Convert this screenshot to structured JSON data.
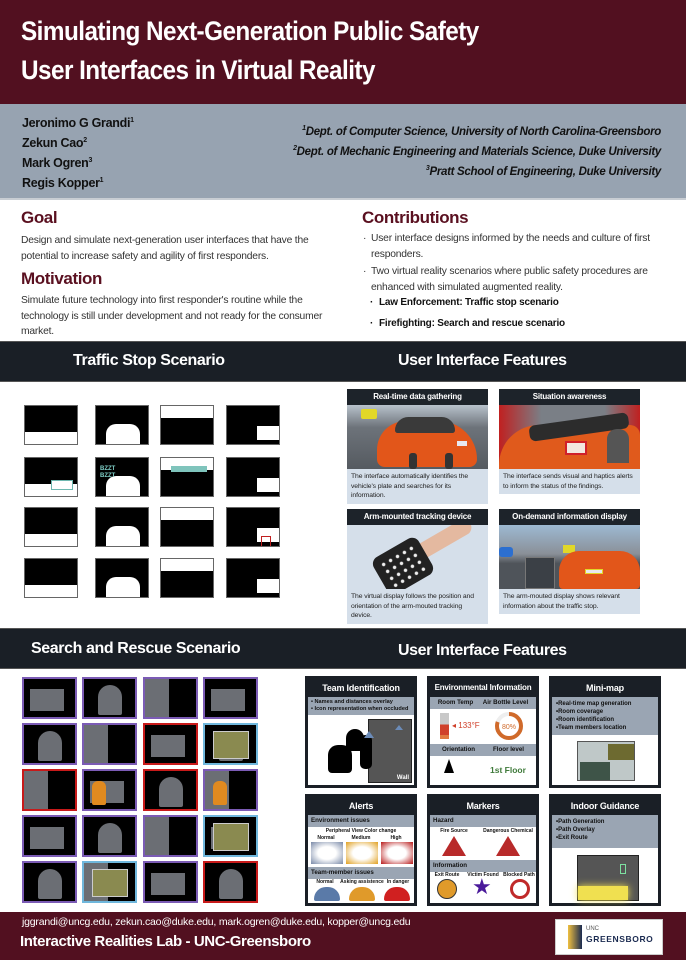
{
  "header": {
    "title_line1": "Simulating Next-Generation Public Safety",
    "title_line2": "User Interfaces in Virtual Reality"
  },
  "authors": [
    {
      "name": "Jeronimo G Grandi",
      "sup": "1"
    },
    {
      "name": "Zekun Cao",
      "sup": "2"
    },
    {
      "name": "Mark Ogren",
      "sup": "3"
    },
    {
      "name": "Regis Kopper",
      "sup": "1"
    }
  ],
  "affiliations": [
    {
      "sup": "1",
      "text": "Dept. of Computer Science, University of North Carolina-Greensboro"
    },
    {
      "sup": "2",
      "text": "Dept. of Mechanic Engineering and Materials Science, Duke University"
    },
    {
      "sup": "3",
      "text": "Pratt School of Engineering, Duke University"
    }
  ],
  "goal": {
    "heading": "Goal",
    "text": "Design and simulate next-generation user interfaces that have the potential to increase safety and agility of first responders."
  },
  "motivation": {
    "heading": "Motivation",
    "text": "Simulate future technology into first responder's routine while the technology is still under development and not ready for the consumer market."
  },
  "contributions": {
    "heading": "Contributions",
    "bullet": "·",
    "items": [
      "User interface designs informed by the needs and culture of first responders.",
      "Two virtual reality scenarios where public safety procedures are enhanced with simulated augmented reality."
    ],
    "subitems": [
      "Law Enforcement: Traffic stop scenario",
      "Firefighting: Search and rescue scenario"
    ]
  },
  "traffic_band": {
    "left_title": "Traffic Stop Scenario",
    "right_title": "User Interface Features"
  },
  "traffic_features": [
    {
      "title": "Real-time data gathering",
      "caption": "The interface automatically identifies the vehicle's plate and searches for its information."
    },
    {
      "title": "Situation awareness",
      "caption": "The interface sends visual and haptics alerts to inform the status of the findings."
    },
    {
      "title": "Arm-mounted tracking device",
      "caption": "The virtual display follows the position and orientation of the  arm-mouted tracking device."
    },
    {
      "title": "On-demand information display",
      "caption": "The arm-mouted display shows relevant information about the traffic stop."
    }
  ],
  "storyboard": {
    "panel_text": [
      "BZZT",
      "BZZT"
    ]
  },
  "rescue_band": {
    "left_title": "Search and Rescue Scenario",
    "right_title": "User Interface Features"
  },
  "ui_cards": {
    "team": {
      "title": "Team Identification",
      "items": [
        "• Names and distances overlay",
        "• Icon representation when occluded"
      ],
      "wall_label": "Wall"
    },
    "env": {
      "title": "Environmental Information",
      "room_temp_label": "Room Temp",
      "air_label": "Air Bottle Level",
      "temp_value": "133°F",
      "air_value": "80%",
      "air_fraction": 0.8,
      "orientation_label": "Orientation",
      "floor_label": "Floor level",
      "floor_value": "1st Floor"
    },
    "minimap": {
      "title": "Mini-map",
      "items": [
        "•Real-time map generation",
        "•Room coverage",
        "•Room identification",
        "•Team members location"
      ]
    },
    "alerts": {
      "title": "Alerts",
      "env_label": "Environment issues",
      "peripheral_label": "Peripheral View Color change",
      "levels": [
        "Normal",
        "Medium",
        "High"
      ],
      "team_label": "Team-member issues",
      "team_levels": [
        "Normal",
        "Asking assistence",
        "In danger"
      ]
    },
    "markers": {
      "title": "Markers",
      "hazard_label": "Hazard",
      "hazards": [
        "Fire Source",
        "Dangerous Chemical"
      ],
      "info_label": "Information",
      "infos": [
        "Exit Route",
        "Victim Found",
        "Blocked Path"
      ]
    },
    "guidance": {
      "title": "Indoor Guidance",
      "items": [
        "•Path Generation",
        "•Path Overlay",
        "•Exit Route"
      ]
    }
  },
  "footer": {
    "emails": "jggrandi@uncg.edu, zekun.cao@duke.edu, mark.ogren@duke.edu, kopper@uncg.edu",
    "lab": "Interactive Realities Lab - UNC-Greensboro",
    "logo_line1": "UNC",
    "logo_line2": "GREENSBORO"
  },
  "colors": {
    "maroon": "#521020",
    "band_dark": "#1a1f26",
    "author_band": "#97a3b1",
    "heading": "#5a1020"
  }
}
